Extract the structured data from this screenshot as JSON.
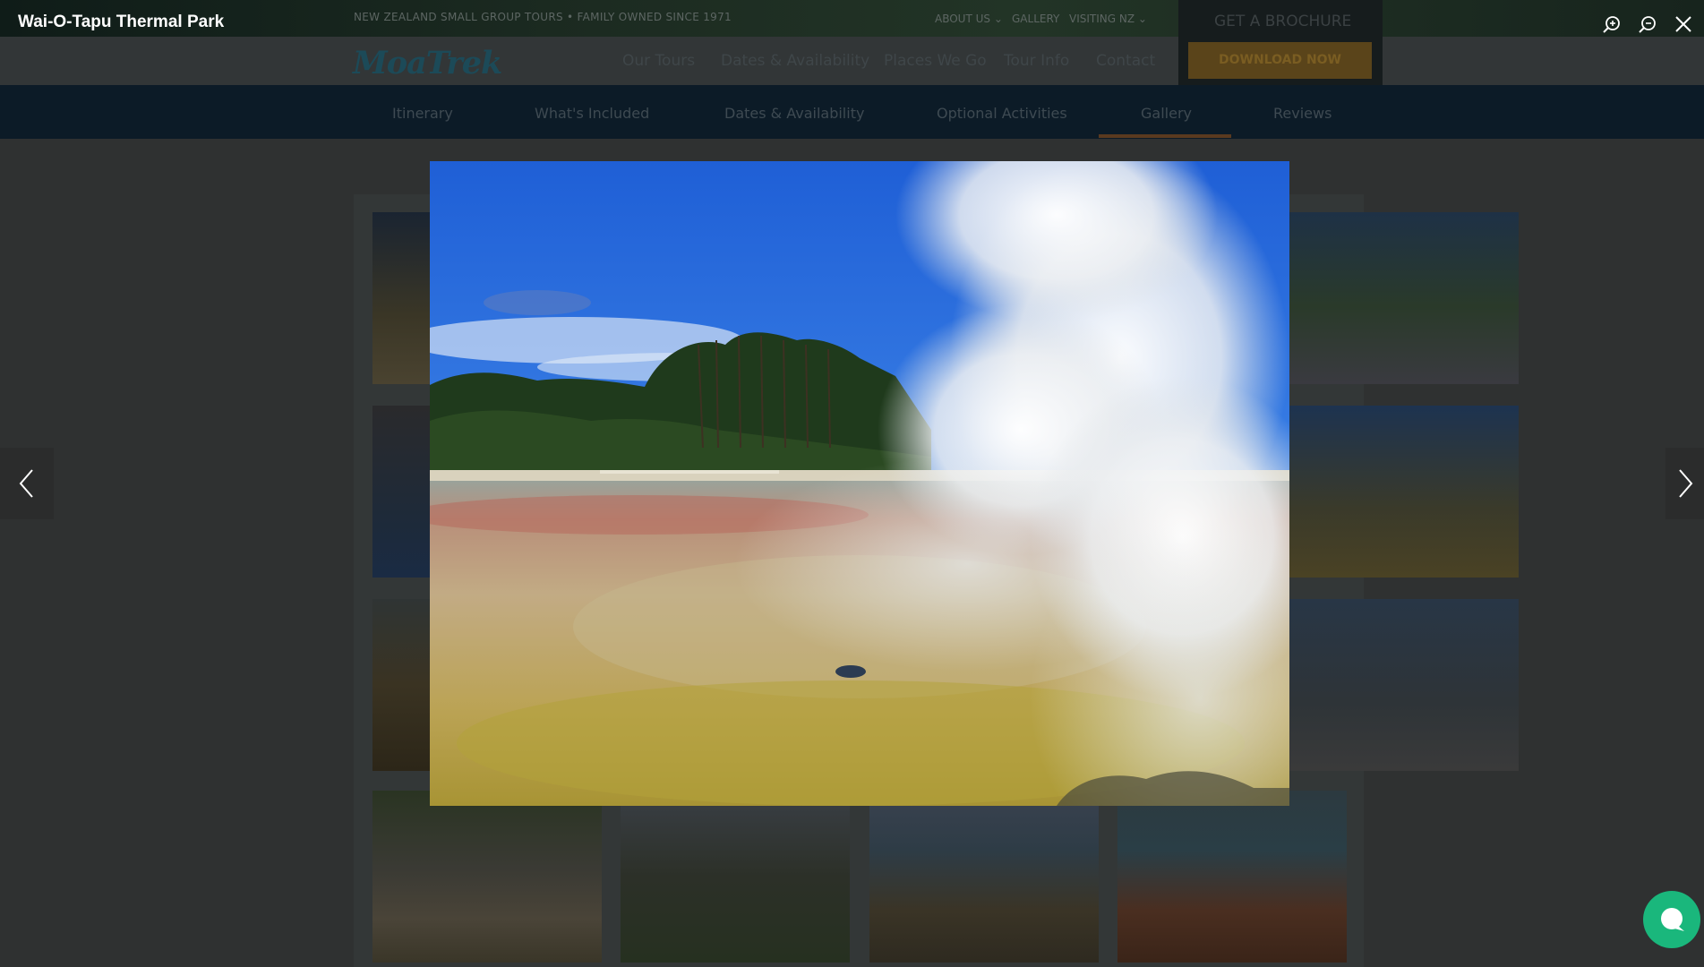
{
  "lightbox": {
    "title": "Wai-O-Tapu Thermal Park",
    "zoom_in_icon": "zoom-in-icon",
    "zoom_out_icon": "zoom-out-icon",
    "close_icon": "close-icon",
    "prev_icon": "chevron-left-icon",
    "next_icon": "chevron-right-icon",
    "image_alt": "Wai-O-Tapu Thermal Park"
  },
  "site": {
    "tagline": "NEW ZEALAND SMALL GROUP TOURS • FAMILY OWNED SINCE 1971",
    "util_links": [
      "ABOUT US ⌄",
      "GALLERY",
      "VISITING NZ ⌄"
    ],
    "logo": "MoaTrek",
    "nav": [
      "Our Tours",
      "Dates & Availability",
      "Places We Go",
      "Tour Info",
      "Contact"
    ],
    "brochure_label": "GET A BROCHURE",
    "download_label": "DOWNLOAD NOW",
    "tabs": [
      "Itinerary",
      "What's Included",
      "Dates & Availability",
      "Optional Activities",
      "Gallery",
      "Reviews"
    ],
    "active_tab": "Gallery"
  },
  "chat": {
    "icon": "chat-bubble-icon"
  },
  "colors": {
    "accent": "#f5a623",
    "chat": "#1ab77c",
    "overlay_text": "#ffffff"
  }
}
